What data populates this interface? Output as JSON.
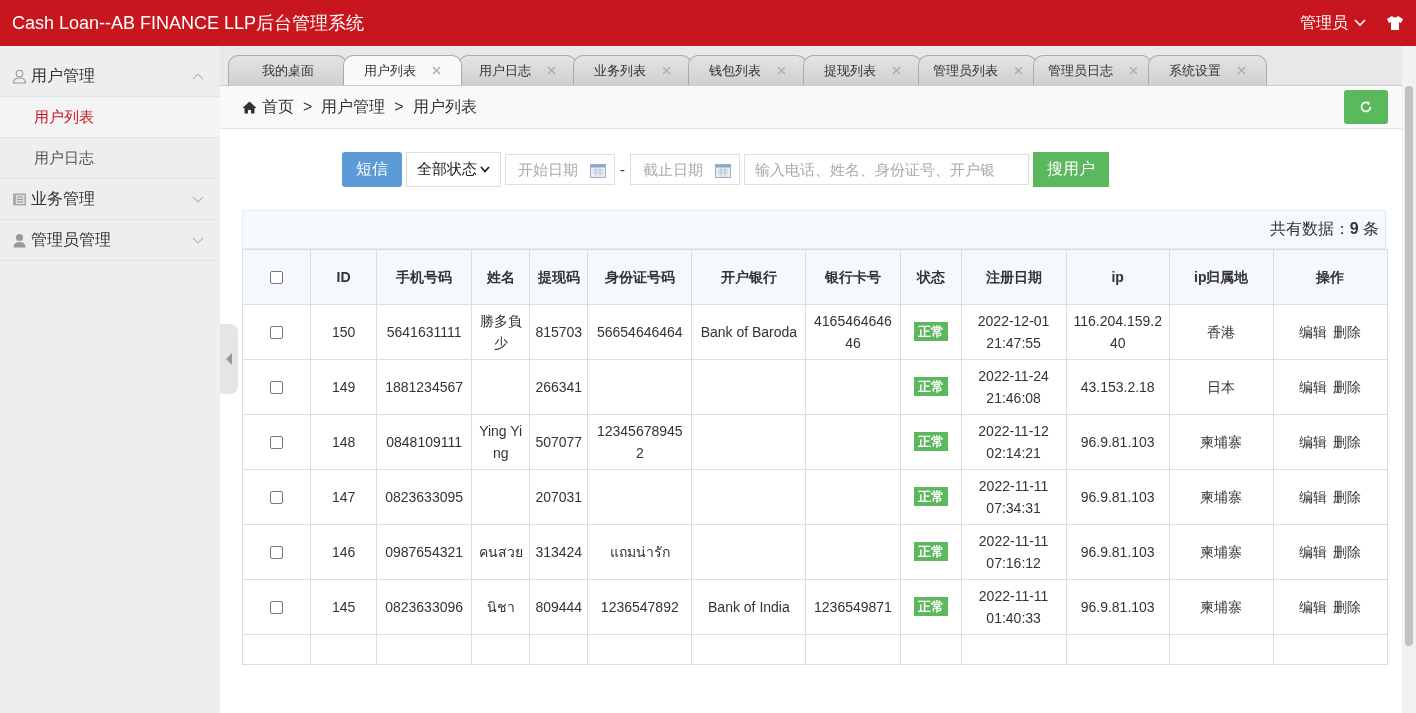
{
  "header": {
    "title": "Cash Loan--AB FINANCE LLP后台管理系统",
    "user": "管理员"
  },
  "sidebar": {
    "groups": [
      {
        "label": "用户管理",
        "expanded": true,
        "items": [
          {
            "label": "用户列表",
            "selected": true
          },
          {
            "label": "用户日志",
            "selected": false
          }
        ]
      },
      {
        "label": "业务管理",
        "expanded": false
      },
      {
        "label": "管理员管理",
        "expanded": false
      }
    ]
  },
  "tabs": [
    {
      "label": "我的桌面",
      "selected": false,
      "closable": false
    },
    {
      "label": "用户列表",
      "selected": true,
      "closable": true
    },
    {
      "label": "用户日志",
      "selected": false,
      "closable": true
    },
    {
      "label": "业务列表",
      "selected": false,
      "closable": true
    },
    {
      "label": "钱包列表",
      "selected": false,
      "closable": true
    },
    {
      "label": "提现列表",
      "selected": false,
      "closable": true
    },
    {
      "label": "管理员列表",
      "selected": false,
      "closable": true
    },
    {
      "label": "管理员日志",
      "selected": false,
      "closable": true
    },
    {
      "label": "系统设置",
      "selected": false,
      "closable": true
    }
  ],
  "breadcrumb": [
    "首页",
    "用户管理",
    "用户列表"
  ],
  "breadcrumb_separator": ">",
  "filter": {
    "sms_button": "短信",
    "status_select": "全部状态",
    "start_date": {
      "placeholder": "开始日期"
    },
    "range_separator": "-",
    "end_date": {
      "placeholder": "截止日期"
    },
    "search": {
      "placeholder": "输入电话、姓名、身份证号、开户银"
    },
    "search_button": "搜用户"
  },
  "table": {
    "total_label": "共有数据：",
    "total_count": "9",
    "total_unit": "条",
    "header_checked": false,
    "columns": [
      "ID",
      "手机号码",
      "姓名",
      "提现码",
      "身份证号码",
      "开户银行",
      "银行卡号",
      "状态",
      "注册日期",
      "ip",
      "ip归属地",
      "操作"
    ],
    "rows": [
      {
        "checked": false,
        "id": "150",
        "phone": "5641631111",
        "name": "勝多負少",
        "code": "815703",
        "id_card": "56654646464",
        "bank": "Bank of Baroda",
        "card": "416546464646",
        "status": "正常",
        "date": "2022-12-01",
        "time": "21:47:55",
        "ip": "116.204.159.240",
        "location": "香港",
        "actions": [
          "编辑",
          "删除"
        ]
      },
      {
        "checked": false,
        "id": "149",
        "phone": "1881234567",
        "name": "",
        "code": "266341",
        "id_card": "",
        "bank": "",
        "card": "",
        "status": "正常",
        "date": "2022-11-24",
        "time": "21:46:08",
        "ip": "43.153.2.18",
        "location": "日本",
        "actions": [
          "编辑",
          "删除"
        ]
      },
      {
        "checked": false,
        "id": "148",
        "phone": "0848109111",
        "name": "Ying Ying",
        "code": "507077",
        "id_card": "123456789452",
        "bank": "",
        "card": "",
        "status": "正常",
        "date": "2022-11-12",
        "time": "02:14:21",
        "ip": "96.9.81.103",
        "location": "柬埔寨",
        "actions": [
          "编辑",
          "删除"
        ]
      },
      {
        "checked": false,
        "id": "147",
        "phone": "0823633095",
        "name": "",
        "code": "207031",
        "id_card": "",
        "bank": "",
        "card": "",
        "status": "正常",
        "date": "2022-11-11",
        "time": "07:34:31",
        "ip": "96.9.81.103",
        "location": "柬埔寨",
        "actions": [
          "编辑",
          "删除"
        ]
      },
      {
        "checked": false,
        "id": "146",
        "phone": "0987654321",
        "name": "คนสวย",
        "code": "313424",
        "id_card": "แถมน่ารัก",
        "bank": "",
        "card": "",
        "status": "正常",
        "date": "2022-11-11",
        "time": "07:16:12",
        "ip": "96.9.81.103",
        "location": "柬埔寨",
        "actions": [
          "编辑",
          "删除"
        ]
      },
      {
        "checked": false,
        "id": "145",
        "phone": "0823633096",
        "name": "นิชา",
        "code": "809444",
        "id_card": "1236547892",
        "bank": "Bank of India",
        "card": "1236549871",
        "status": "正常",
        "date": "2022-11-11",
        "time": "01:40:33",
        "ip": "96.9.81.103",
        "location": "柬埔寨",
        "actions": [
          "编辑",
          "删除"
        ]
      }
    ]
  }
}
